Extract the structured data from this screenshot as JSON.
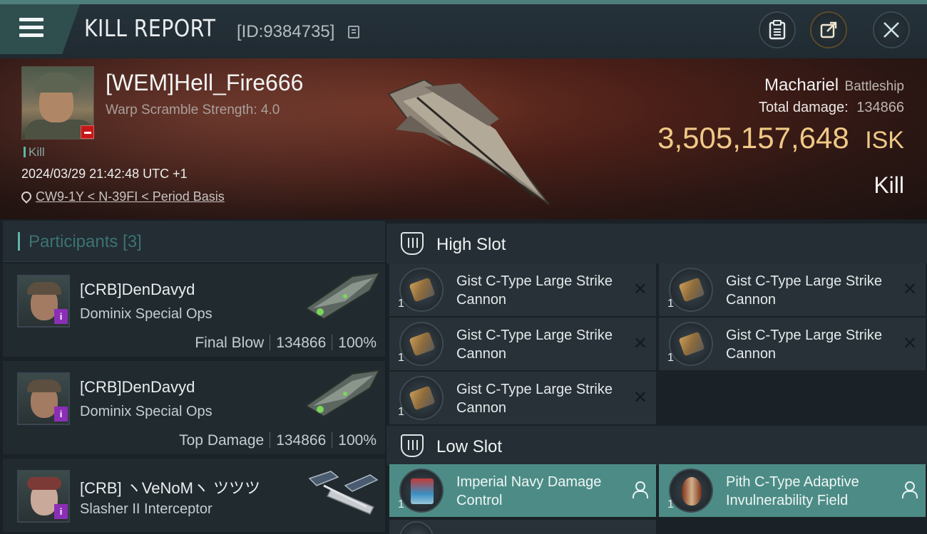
{
  "header": {
    "title": "KILL REPORT",
    "report_id": "[ID:9384735]"
  },
  "victim": {
    "name": "[WEM]Hell_Fire666",
    "warp_scramble": "Warp Scramble Strength: 4.0",
    "kill_tag": "Kill",
    "datetime": "2024/03/29 21:42:48 UTC +1",
    "location": "CW9-1Y < N-39FI < Period Basis",
    "ship_name": "Machariel",
    "ship_class": "Battleship",
    "total_damage_label": "Total damage:",
    "total_damage": "134866",
    "isk_value": "3,505,157,648",
    "isk_unit": "ISK",
    "result": "Kill"
  },
  "participants": {
    "title": "Participants [3]",
    "items": [
      {
        "name": "[CRB]DenDavyd",
        "ship": "Dominix Special Ops",
        "role": "Final Blow",
        "damage": "134866",
        "percent": "100%"
      },
      {
        "name": "[CRB]DenDavyd",
        "ship": "Dominix Special Ops",
        "role": "Top Damage",
        "damage": "134866",
        "percent": "100%"
      },
      {
        "name": "[CRB] ヽVeNoMヽ ツツツ",
        "ship": "Slasher II Interceptor"
      }
    ]
  },
  "slots": {
    "high": {
      "label": "High Slot",
      "modules": [
        {
          "name": "Gist C-Type Large Strike Cannon",
          "qty": "1"
        },
        {
          "name": "Gist C-Type Large Strike Cannon",
          "qty": "1"
        },
        {
          "name": "Gist C-Type Large Strike Cannon",
          "qty": "1"
        },
        {
          "name": "Gist C-Type Large Strike Cannon",
          "qty": "1"
        },
        {
          "name": "Gist C-Type Large Strike Cannon",
          "qty": "1"
        }
      ]
    },
    "low": {
      "label": "Low Slot",
      "modules": [
        {
          "name": "Imperial Navy Damage Control",
          "qty": "1"
        },
        {
          "name": "Pith C-Type Adaptive Invulnerability Field",
          "qty": "1"
        }
      ]
    }
  },
  "colors": {
    "accent": "#5fb5a9",
    "isk": "#f0c987",
    "dropped_module": "#4d8c86",
    "badge_red": "#c51818",
    "badge_purple": "#8a2fb5"
  }
}
